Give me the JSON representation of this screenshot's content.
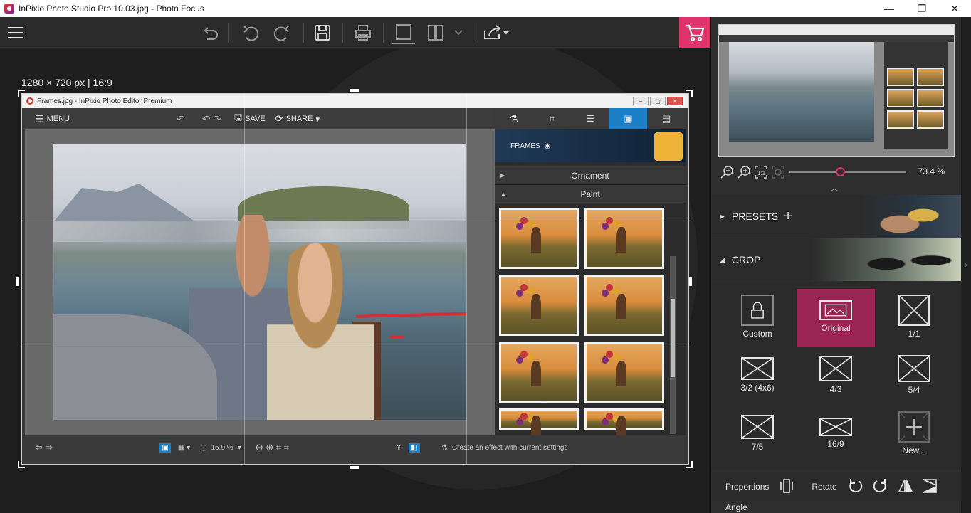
{
  "window": {
    "title": "InPixio Photo Studio Pro 10.03.jpg - Photo Focus",
    "minimize": "—",
    "maximize": "❐",
    "close": "✕"
  },
  "canvas": {
    "dimensions_label": "1280 × 720 px | 16:9"
  },
  "embedded": {
    "title": "Frames.jpg - InPixio Photo Editor Premium",
    "menu_label": "MENU",
    "save_label": "SAVE",
    "share_label": "SHARE",
    "frames_label": "FRAMES",
    "accordion": [
      {
        "label": "Ornament",
        "arrow": "▶"
      },
      {
        "label": "Paint",
        "arrow": "▲"
      }
    ],
    "zoom_value": "15.9 %",
    "create_effect_label": "Create an effect with current settings"
  },
  "navigator": {
    "zoom_value": "73.4 %",
    "zoom_fraction": 0.43
  },
  "sections": {
    "presets": "PRESETS",
    "crop": "CROP"
  },
  "crop_ratios": [
    {
      "label": "Custom",
      "kind": "lock"
    },
    {
      "label": "Original",
      "kind": "image",
      "active": true
    },
    {
      "label": "1/1",
      "kind": "box"
    },
    {
      "label": "3/2 (4x6)",
      "kind": "box"
    },
    {
      "label": "4/3",
      "kind": "box"
    },
    {
      "label": "5/4",
      "kind": "box"
    },
    {
      "label": "7/5",
      "kind": "box"
    },
    {
      "label": "16/9",
      "kind": "box"
    },
    {
      "label": "New...",
      "kind": "plus"
    }
  ],
  "bottom": {
    "proportions_label": "Proportions",
    "rotate_label": "Rotate",
    "angle_label": "Angle"
  },
  "colors": {
    "accent": "#e0336c",
    "active_ratio": "#9a2552",
    "panel": "#2e2e2e"
  }
}
